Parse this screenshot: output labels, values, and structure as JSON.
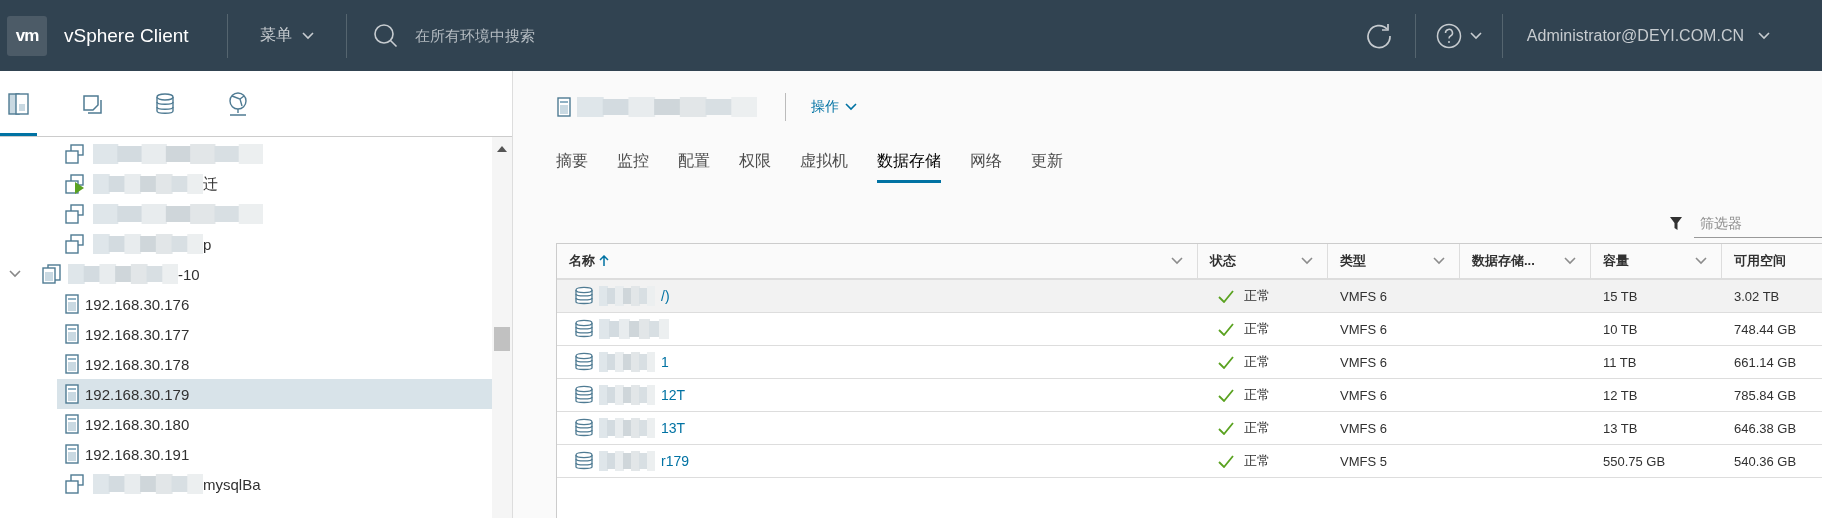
{
  "header": {
    "logo": "vm",
    "product": "vSphere Client",
    "menu": "菜单",
    "search": {
      "placeholder": "在所有环境中搜索"
    },
    "user": "Administrator@DEYI.COM.CN"
  },
  "nav": {
    "tabs": [
      {
        "kind": "hosts",
        "selected": true
      },
      {
        "kind": "vms",
        "selected": false
      },
      {
        "kind": "storage",
        "selected": false
      },
      {
        "kind": "network",
        "selected": false
      }
    ],
    "continued_children": [
      {
        "kind": "vm",
        "redacted": true,
        "powered_on": false,
        "selected": false
      },
      {
        "kind": "vm",
        "label": "迁",
        "redacted": true,
        "powered_on": true,
        "selected": false
      },
      {
        "kind": "vm",
        "redacted": true,
        "powered_on": false,
        "selected": false
      },
      {
        "kind": "vm",
        "label": "p",
        "redacted": true,
        "powered_on": false,
        "selected": false
      }
    ],
    "tree": [
      {
        "kind": "cluster",
        "label": "-10",
        "redacted": true,
        "expanded": true,
        "selected": false,
        "children": [
          {
            "kind": "host",
            "label": "192.168.30.176",
            "redacted": false,
            "selected": false
          },
          {
            "kind": "host",
            "label": "192.168.30.177",
            "redacted": false,
            "selected": false
          },
          {
            "kind": "host",
            "label": "192.168.30.178",
            "redacted": false,
            "selected": false
          },
          {
            "kind": "host",
            "label": "192.168.30.179",
            "redacted": false,
            "selected": true
          },
          {
            "kind": "host",
            "label": "192.168.30.180",
            "redacted": false,
            "selected": false
          },
          {
            "kind": "host",
            "label": "192.168.30.191",
            "redacted": false,
            "selected": false
          },
          {
            "kind": "vm",
            "label": "mysqlBa",
            "redacted": true,
            "powered_on": false,
            "selected": false
          }
        ]
      }
    ]
  },
  "main": {
    "title": {
      "redacted": true
    },
    "actions": "操作",
    "tabs": [
      {
        "label": "摘要",
        "selected": false
      },
      {
        "label": "监控",
        "selected": false
      },
      {
        "label": "配置",
        "selected": false
      },
      {
        "label": "权限",
        "selected": false
      },
      {
        "label": "虚拟机",
        "selected": false
      },
      {
        "label": "数据存储",
        "selected": true
      },
      {
        "label": "网络",
        "selected": false
      },
      {
        "label": "更新",
        "selected": false
      }
    ],
    "filter": {
      "placeholder": "筛选器"
    },
    "table": {
      "columns": [
        {
          "label": "名称",
          "sorted": true
        },
        {
          "label": "状态",
          "sorted": false
        },
        {
          "label": "类型",
          "sorted": false
        },
        {
          "label": "数据存储...",
          "sorted": false
        },
        {
          "label": "容量",
          "sorted": false
        },
        {
          "label": "可用空间",
          "sorted": false
        }
      ],
      "rows": [
        {
          "name": "/)",
          "redacted": true,
          "status": "正常",
          "ok": true,
          "type": "VMFS 6",
          "capacity": "15 TB",
          "free": "3.02 TB",
          "selected": true
        },
        {
          "redacted": true,
          "status": "正常",
          "ok": true,
          "type": "VMFS 6",
          "capacity": "10 TB",
          "free": "748.44 GB",
          "selected": false
        },
        {
          "name": "1",
          "redacted": true,
          "status": "正常",
          "ok": true,
          "type": "VMFS 6",
          "capacity": "11 TB",
          "free": "661.14 GB",
          "selected": false
        },
        {
          "name": "12T",
          "redacted": true,
          "status": "正常",
          "ok": true,
          "type": "VMFS 6",
          "capacity": "12 TB",
          "free": "785.84 GB",
          "selected": false
        },
        {
          "name": "13T",
          "redacted": true,
          "status": "正常",
          "ok": true,
          "type": "VMFS 6",
          "capacity": "13 TB",
          "free": "646.38 GB",
          "selected": false
        },
        {
          "name": "r179",
          "redacted": true,
          "status": "正常",
          "ok": true,
          "type": "VMFS 5",
          "capacity": "550.75 GB",
          "free": "540.36 GB",
          "selected": false
        }
      ]
    }
  }
}
